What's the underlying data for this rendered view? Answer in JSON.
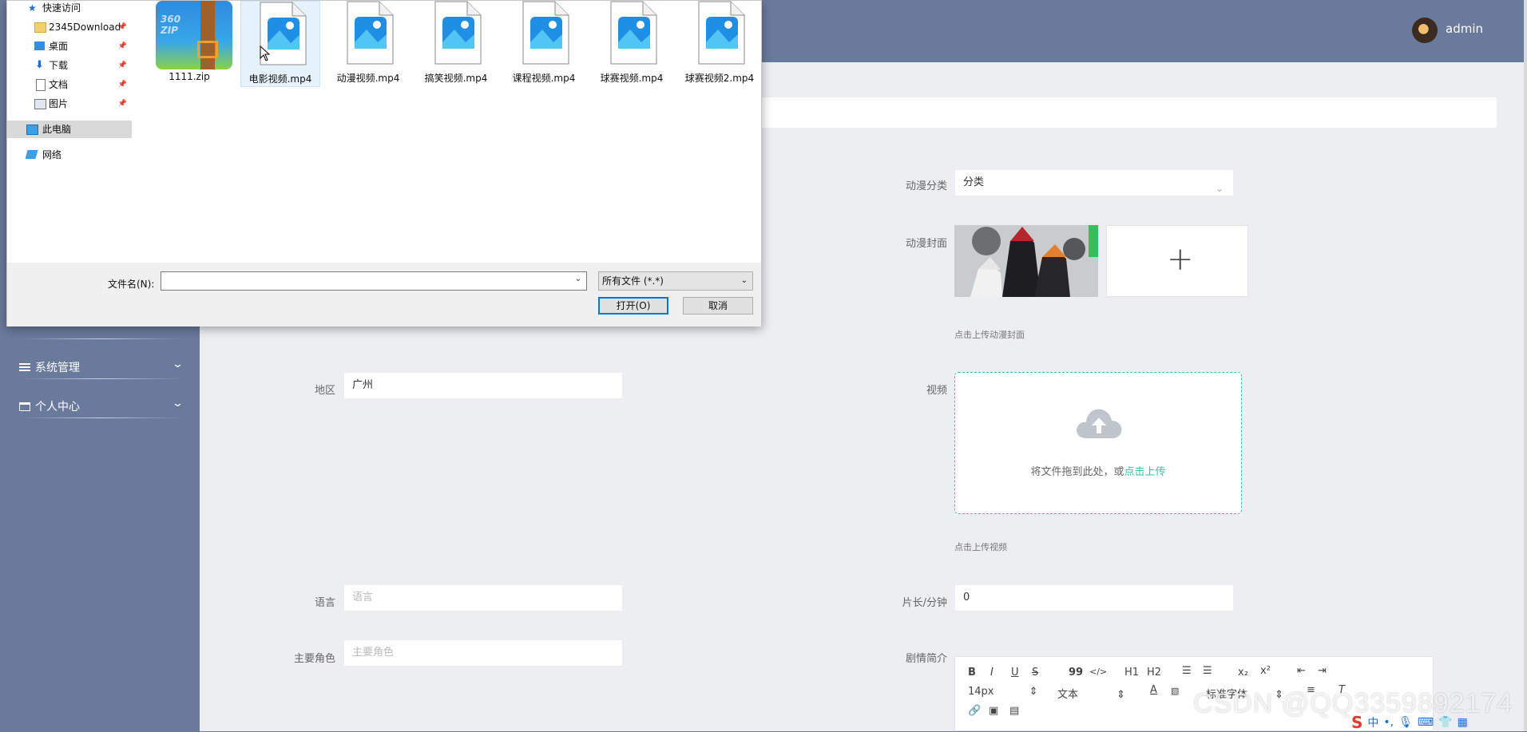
{
  "header": {
    "username": "admin"
  },
  "sidebar": {
    "items": [
      {
        "label": "系统管理"
      },
      {
        "label": "个人中心"
      }
    ]
  },
  "form": {
    "category": {
      "label": "动漫分类",
      "value": "分类"
    },
    "cover": {
      "label": "动漫封面",
      "hint": "点击上传动漫封面"
    },
    "region": {
      "label": "地区",
      "value": "广州"
    },
    "video": {
      "label": "视频",
      "drop_text": "将文件拖到此处，或",
      "drop_link": "点击上传",
      "hint": "点击上传视频"
    },
    "language": {
      "label": "语言",
      "placeholder": "语言"
    },
    "duration": {
      "label": "片长/分钟",
      "value": "0"
    },
    "roles": {
      "label": "主要角色",
      "placeholder": "主要角色"
    },
    "synopsis": {
      "label": "剧情简介"
    }
  },
  "editor": {
    "size_select": "14px",
    "text_select": "文本",
    "font_select": "标准字体",
    "buttons": {
      "bold": "B",
      "italic": "I",
      "underline": "U",
      "strike": "S",
      "quote": "99",
      "code": "</>",
      "h1": "H1",
      "h2": "H2",
      "sub": "x₂",
      "sup": "x²"
    }
  },
  "dialog": {
    "nav": [
      {
        "label": "快速访问",
        "icon": "star-icon"
      },
      {
        "label": "2345Download",
        "icon": "folder-icon",
        "pinned": true
      },
      {
        "label": "桌面",
        "icon": "desktop-icon",
        "pinned": true
      },
      {
        "label": "下载",
        "icon": "download-icon",
        "pinned": true
      },
      {
        "label": "文档",
        "icon": "document-icon",
        "pinned": true
      },
      {
        "label": "图片",
        "icon": "picture-icon",
        "pinned": true
      },
      {
        "label": "此电脑",
        "icon": "computer-icon"
      },
      {
        "label": "网络",
        "icon": "network-icon"
      }
    ],
    "files": [
      {
        "name": "1111.zip",
        "type": "zip"
      },
      {
        "name": "电影视频.mp4",
        "type": "image"
      },
      {
        "name": "动漫视频.mp4",
        "type": "image"
      },
      {
        "name": "搞笑视频.mp4",
        "type": "image"
      },
      {
        "name": "课程视频.mp4",
        "type": "image"
      },
      {
        "name": "球赛视频.mp4",
        "type": "image"
      },
      {
        "name": "球赛视频2.mp4",
        "type": "image"
      }
    ],
    "filename_label": "文件名(N):",
    "filename_value": "",
    "filetype": "所有文件 (*.*)",
    "open_button": "打开(O)",
    "cancel_button": "取消"
  },
  "watermark": "CSDN @QQ3359892174",
  "tray": {
    "ime": "中"
  },
  "colors": {
    "sidebar": "#6a7a9c",
    "accent": "#35c5a1",
    "content_bg": "#eceef2",
    "dialog_primary": "#0078d7"
  }
}
